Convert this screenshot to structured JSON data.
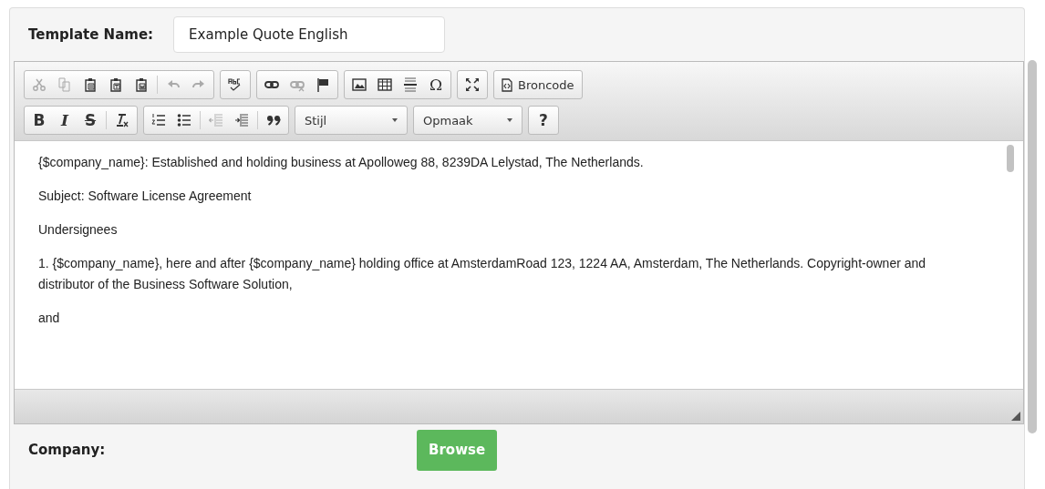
{
  "template_name": {
    "label": "Template Name:",
    "value": "Example Quote English"
  },
  "toolbar": {
    "rows": [
      [
        [
          {
            "kind": "cut",
            "disabled": true
          },
          {
            "kind": "copy",
            "disabled": true
          },
          {
            "kind": "paste",
            "disabled": false
          },
          {
            "kind": "paste-text",
            "disabled": false
          },
          {
            "kind": "paste-word",
            "disabled": false
          },
          {
            "kind": "separator"
          },
          {
            "kind": "undo",
            "disabled": true
          },
          {
            "kind": "redo",
            "disabled": true
          }
        ],
        [
          {
            "kind": "spellcheck",
            "disabled": false
          }
        ],
        [
          {
            "kind": "link",
            "disabled": false
          },
          {
            "kind": "unlink",
            "disabled": true
          },
          {
            "kind": "anchor",
            "disabled": false
          }
        ],
        [
          {
            "kind": "image",
            "disabled": false
          },
          {
            "kind": "table",
            "disabled": false
          },
          {
            "kind": "rule",
            "disabled": false
          },
          {
            "kind": "special-char",
            "glyph": "Ω",
            "disabled": false
          }
        ],
        [
          {
            "kind": "maximize",
            "disabled": false
          }
        ],
        [
          {
            "kind": "source",
            "label": "Broncode",
            "disabled": false
          }
        ]
      ],
      [
        [
          {
            "kind": "bold",
            "glyph": "B",
            "disabled": false
          },
          {
            "kind": "italic",
            "glyph": "I",
            "disabled": false
          },
          {
            "kind": "strike",
            "glyph": "S",
            "disabled": false
          },
          {
            "kind": "separator"
          },
          {
            "kind": "remove-format",
            "disabled": false
          }
        ],
        [
          {
            "kind": "numbered-list",
            "disabled": false
          },
          {
            "kind": "bullet-list",
            "disabled": false
          },
          {
            "kind": "separator"
          },
          {
            "kind": "outdent",
            "disabled": true
          },
          {
            "kind": "indent",
            "disabled": false
          },
          {
            "kind": "separator"
          },
          {
            "kind": "quote",
            "disabled": false
          }
        ],
        [
          {
            "kind": "combo",
            "label": "Stijl"
          }
        ],
        [
          {
            "kind": "combo",
            "label": "Opmaak"
          }
        ],
        [
          {
            "kind": "help",
            "glyph": "?",
            "disabled": false
          }
        ]
      ]
    ]
  },
  "content": [
    "{$company_name}: Established and holding business at Apolloweg 88, 8239DA Lelystad, The Netherlands.",
    "Subject: Software License Agreement",
    "Undersignees",
    "1. {$company_name}, here and after {$company_name} holding office at AmsterdamRoad 123, 1224 AA, Amsterdam, The Netherlands. Copyright-owner and distributor of the Business Software Solution,",
    "and"
  ],
  "company": {
    "label": "Company:",
    "button": "Browse"
  }
}
